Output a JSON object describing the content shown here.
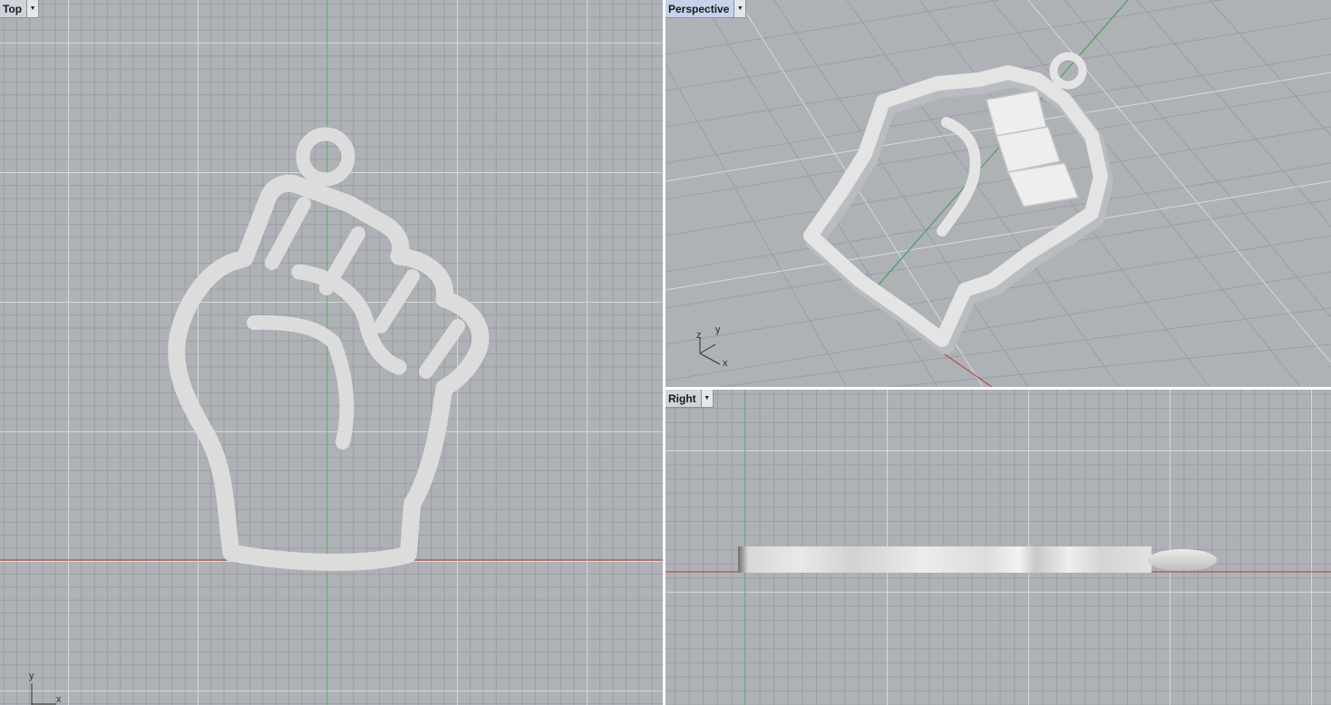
{
  "viewports": {
    "top": {
      "name": "Top",
      "dropdown_icon": "triangle-down-icon",
      "axis_y": "y",
      "axis_x": "x"
    },
    "perspective": {
      "name": "Perspective",
      "dropdown_icon": "triangle-down-icon",
      "axis_z": "z",
      "axis_y": "y",
      "axis_x": "x",
      "active": true
    },
    "right": {
      "name": "Right",
      "dropdown_icon": "triangle-down-icon"
    }
  },
  "colors": {
    "background": "#aeb1b6",
    "grid_minor": "#9a9da3",
    "grid_major": "#d7d9dd",
    "axis_x": "#b0402f",
    "axis_y": "#3f9f4a",
    "model": "#dcdcdc",
    "viewport_border": "#ffffff"
  }
}
